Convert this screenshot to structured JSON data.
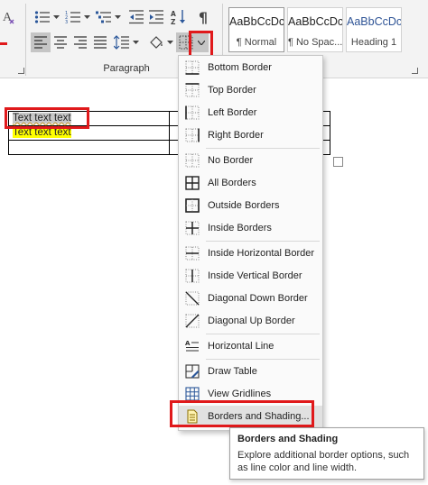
{
  "ribbon": {
    "paragraph_group_label": "Paragraph",
    "pilcrow_symbol": "¶",
    "styles": [
      {
        "sample": "AaBbCcDc",
        "name": "¶ Normal",
        "selected": true
      },
      {
        "sample": "AaBbCcDc",
        "name": "¶ No Spac...",
        "selected": false
      },
      {
        "sample": "AaBbCcDc",
        "name": "Heading 1",
        "selected": false
      }
    ],
    "accent_red": "#e0191b"
  },
  "document": {
    "rows": [
      [
        "Text text text",
        "",
        ""
      ],
      [
        "Text text text",
        "",
        ""
      ],
      [
        "",
        "",
        ""
      ]
    ],
    "highlight_colors": {
      "selected": "#c8c8c8",
      "yellow": "#ffff00"
    }
  },
  "borders_menu": {
    "items": [
      {
        "id": "bottom-border",
        "label": "Bottom Border",
        "icon": "bottom-border-icon"
      },
      {
        "id": "top-border",
        "label": "Top Border",
        "icon": "top-border-icon"
      },
      {
        "id": "left-border",
        "label": "Left Border",
        "icon": "left-border-icon"
      },
      {
        "id": "right-border",
        "label": "Right Border",
        "icon": "right-border-icon"
      },
      {
        "id": "no-border",
        "label": "No Border",
        "icon": "no-border-icon"
      },
      {
        "id": "all-borders",
        "label": "All Borders",
        "icon": "all-borders-icon"
      },
      {
        "id": "outside-borders",
        "label": "Outside Borders",
        "icon": "outside-borders-icon"
      },
      {
        "id": "inside-borders",
        "label": "Inside Borders",
        "icon": "inside-borders-icon"
      },
      {
        "id": "inside-horizontal-border",
        "label": "Inside Horizontal Border",
        "icon": "inside-horizontal-border-icon"
      },
      {
        "id": "inside-vertical-border",
        "label": "Inside Vertical Border",
        "icon": "inside-vertical-border-icon"
      },
      {
        "id": "diagonal-down-border",
        "label": "Diagonal Down Border",
        "icon": "diagonal-down-border-icon"
      },
      {
        "id": "diagonal-up-border",
        "label": "Diagonal Up Border",
        "icon": "diagonal-up-border-icon"
      },
      {
        "id": "horizontal-line",
        "label": "Horizontal Line",
        "icon": "horizontal-line-icon"
      },
      {
        "id": "draw-table",
        "label": "Draw Table",
        "icon": "draw-table-icon"
      },
      {
        "id": "view-gridlines",
        "label": "View Gridlines",
        "icon": "view-gridlines-icon"
      },
      {
        "id": "borders-and-shading",
        "label": "Borders and Shading...",
        "icon": "borders-shading-icon",
        "hovered": true
      }
    ]
  },
  "tooltip": {
    "title": "Borders and Shading",
    "body": "Explore additional border options, such as line color and line width."
  }
}
